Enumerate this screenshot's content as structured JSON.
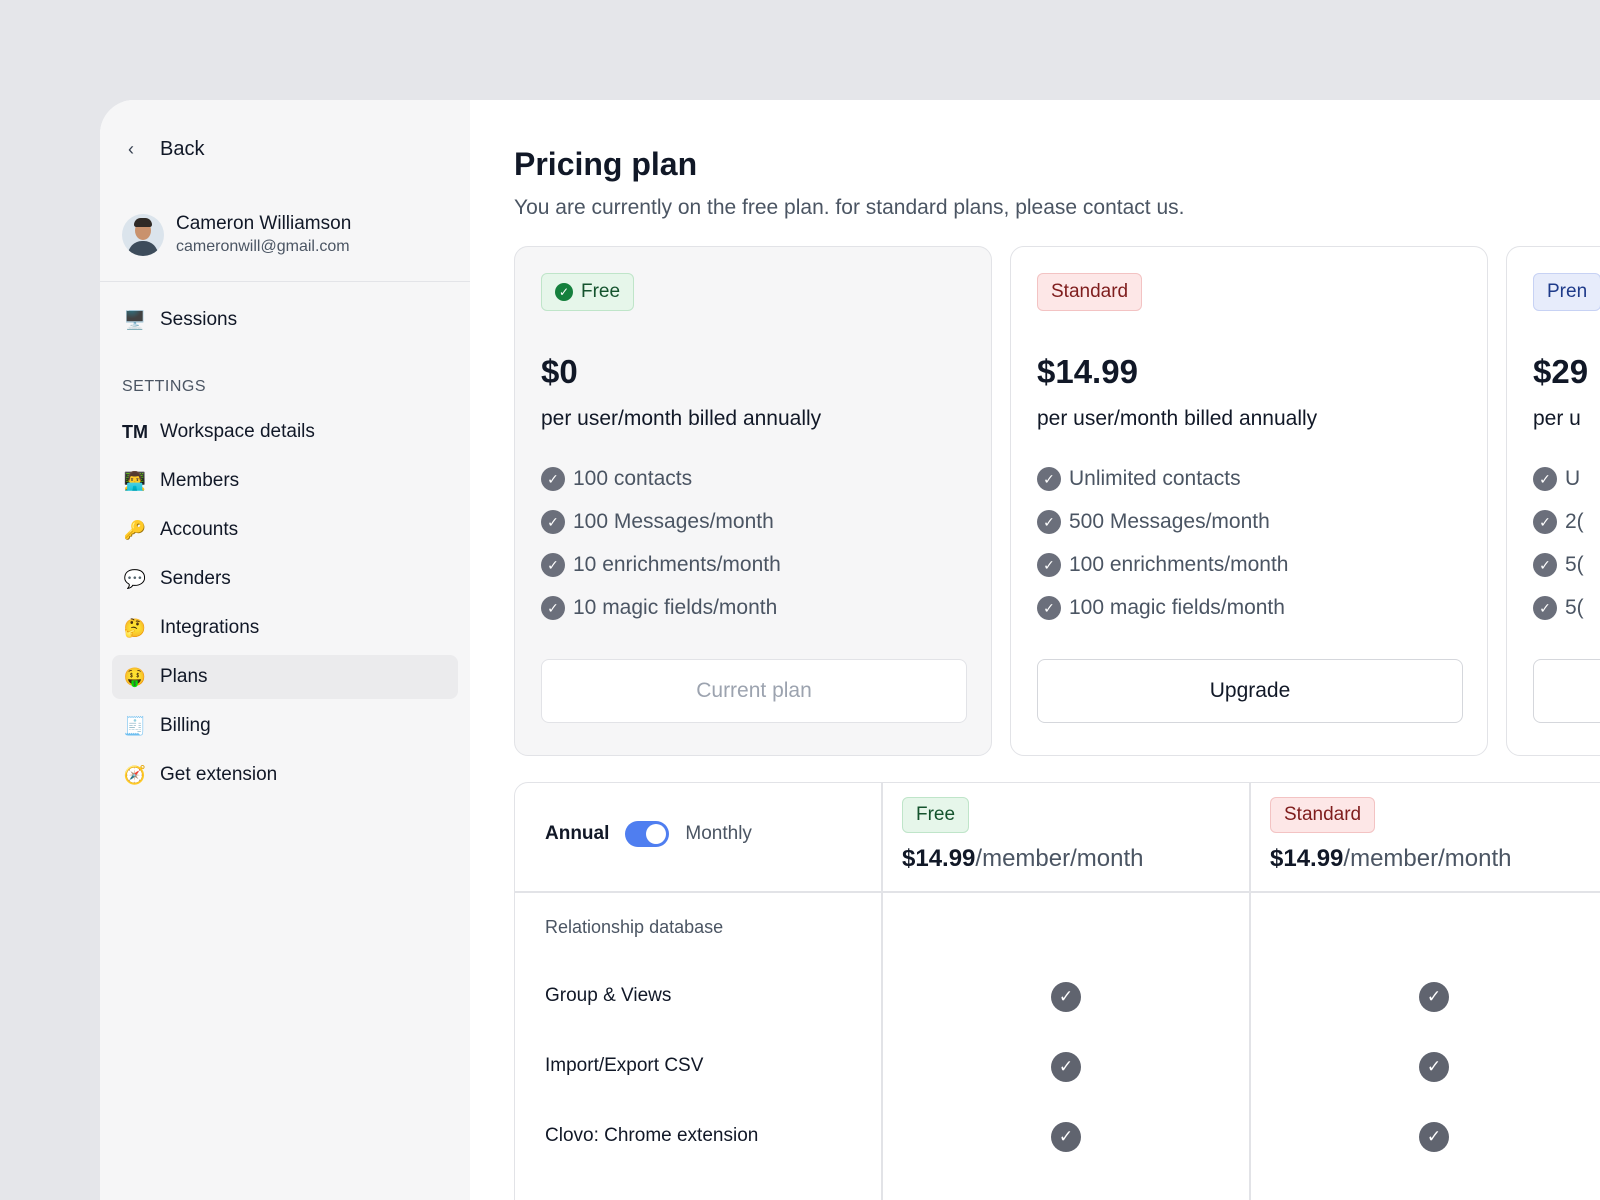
{
  "sidebar": {
    "back_label": "Back",
    "user": {
      "name": "Cameron Williamson",
      "email": "cameronwill@gmail.com"
    },
    "sessions_label": "Sessions",
    "settings_label": "SETTINGS",
    "items": [
      {
        "label": "Workspace details",
        "icon": "TM"
      },
      {
        "label": "Members",
        "icon": "👨‍💻"
      },
      {
        "label": "Accounts",
        "icon": "🔑"
      },
      {
        "label": "Senders",
        "icon": "💬"
      },
      {
        "label": "Integrations",
        "icon": "🤔"
      },
      {
        "label": "Plans",
        "icon": "🤑"
      },
      {
        "label": "Billing",
        "icon": "🧾"
      },
      {
        "label": "Get extension",
        "icon": "🧭"
      }
    ],
    "active_item": "Plans"
  },
  "main": {
    "title": "Pricing plan",
    "subtitle": "You are currently on the free plan. for standard plans, please contact us.",
    "plans": [
      {
        "badge": "Free",
        "price": "$0",
        "billing": "per user/month billed annually",
        "features": [
          "100 contacts",
          "100 Messages/month",
          "10 enrichments/month",
          "10 magic fields/month"
        ],
        "button": "Current plan",
        "current": true
      },
      {
        "badge": "Standard",
        "price": "$14.99",
        "billing": "per user/month billed annually",
        "features": [
          "Unlimited contacts",
          "500 Messages/month",
          "100 enrichments/month",
          "100 magic fields/month"
        ],
        "button": "Upgrade",
        "current": false
      },
      {
        "badge": "Pren",
        "price": "$29",
        "billing": "per u",
        "features": [
          "U",
          "2(",
          "5(",
          "5("
        ],
        "button": "",
        "current": false
      }
    ],
    "comparison": {
      "toggle": {
        "left_label": "Annual",
        "right_label": "Monthly",
        "state": "on"
      },
      "columns": [
        {
          "badge": "Free",
          "price": "$14.99",
          "unit": "/member/month"
        },
        {
          "badge": "Standard",
          "price": "$14.99",
          "unit": "/member/month"
        }
      ],
      "group": "Relationship database",
      "rows": [
        {
          "label": "Group & Views",
          "free": true,
          "standard": true
        },
        {
          "label": "Import/Export CSV",
          "free": true,
          "standard": true
        },
        {
          "label": "Clovo: Chrome extension",
          "free": true,
          "standard": true
        }
      ]
    }
  },
  "colors": {
    "accent": "#4f7ef0",
    "free_badge_bg": "#e6f6ea",
    "standard_badge_bg": "#fde7e7",
    "premium_badge_bg": "#e7ecfb",
    "check": "#6b6f7b"
  }
}
